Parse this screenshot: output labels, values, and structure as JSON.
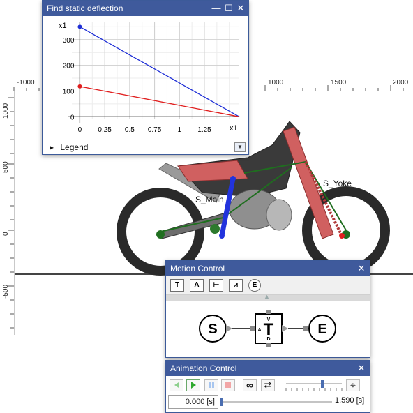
{
  "deflection": {
    "title": "Find static deflection",
    "minimize_glyph": "—",
    "maximize_glyph": "☐",
    "close_glyph": "✕",
    "y_multiplier": "x1",
    "x_multiplier": "x1",
    "y_ticks": [
      "300",
      "200",
      "100",
      "0"
    ],
    "x_ticks": [
      "0",
      "0.25",
      "0.5",
      "0.75",
      "1",
      "1.25"
    ],
    "legend_label": "Legend",
    "legend_arrow": "▸",
    "legend_toggle_glyph": "▼"
  },
  "chart_data": {
    "type": "line",
    "title": "Find static deflection",
    "xlim": [
      -0.08,
      1.6
    ],
    "ylim": [
      -10,
      370
    ],
    "grid": true,
    "series": [
      {
        "color": "#1f2fd6",
        "x": [
          0,
          1.6
        ],
        "y": [
          350,
          0
        ]
      },
      {
        "color": "#e01e1e",
        "x": [
          0,
          1.6
        ],
        "y": [
          118,
          0
        ]
      }
    ]
  },
  "rulers": {
    "top_labels": [
      "-1000",
      "1000",
      "1500",
      "2000"
    ],
    "left_labels": [
      "1000",
      "500",
      "0",
      "-500"
    ]
  },
  "model": {
    "main_label": "S_Main",
    "yoke_label": "S_Yoke",
    "colors": {
      "frame": "#3a3a3a",
      "accent": "#d06060",
      "spring_blue": "#2233dd",
      "joint_green": "#1f6e1f"
    }
  },
  "motion": {
    "title": "Motion Control",
    "close_glyph": "✕",
    "tools": [
      "T",
      "A",
      "⊢",
      "⩘",
      "E"
    ],
    "collapse_glyph": "▲",
    "start_label": "S",
    "end_label": "E",
    "t_label": "T",
    "v_label": "V",
    "a_label": "A",
    "d_label": "D"
  },
  "animation": {
    "title": "Animation Control",
    "close_glyph": "✕",
    "loop_glyph": "∞",
    "swap_glyph": "⇄",
    "target_glyph": "⌖",
    "current_time": "0.000 [s]",
    "end_time": "1.590 [s]",
    "progress": 0.0,
    "speed_level": 0.65
  }
}
